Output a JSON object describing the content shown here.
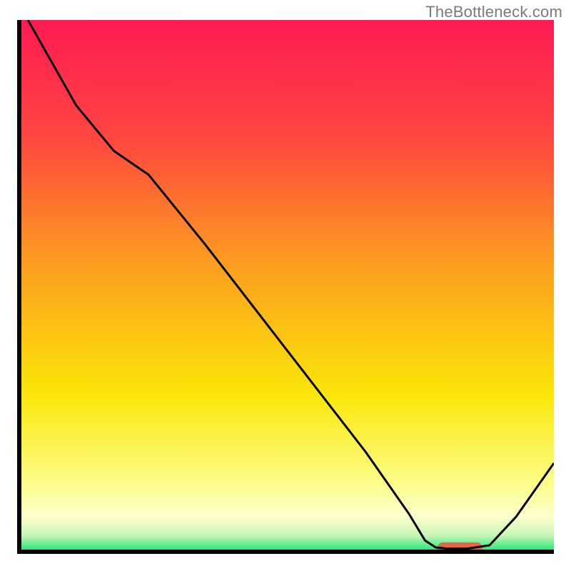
{
  "watermark": "TheBottleneck.com",
  "chart_data": {
    "type": "line",
    "title": "",
    "xlabel": "",
    "ylabel": "",
    "xlim": [
      0,
      100
    ],
    "ylim": [
      0,
      100
    ],
    "grid": false,
    "legend": "none",
    "gradient_stops": [
      {
        "offset": 0.0,
        "color": "#ff1a53"
      },
      {
        "offset": 0.22,
        "color": "#ff4640"
      },
      {
        "offset": 0.45,
        "color": "#fc9b20"
      },
      {
        "offset": 0.7,
        "color": "#fbe608"
      },
      {
        "offset": 0.86,
        "color": "#fdfc82"
      },
      {
        "offset": 0.93,
        "color": "#fdffcb"
      },
      {
        "offset": 0.965,
        "color": "#c8f7b6"
      },
      {
        "offset": 1.0,
        "color": "#00e46f"
      }
    ],
    "curve": [
      {
        "x": 2.0,
        "y": 100.0
      },
      {
        "x": 11.0,
        "y": 84.0
      },
      {
        "x": 18.0,
        "y": 75.5
      },
      {
        "x": 24.5,
        "y": 71.0
      },
      {
        "x": 35.0,
        "y": 58.0
      },
      {
        "x": 50.0,
        "y": 38.5
      },
      {
        "x": 65.0,
        "y": 19.0
      },
      {
        "x": 73.0,
        "y": 7.5
      },
      {
        "x": 76.0,
        "y": 2.5
      },
      {
        "x": 78.0,
        "y": 1.2
      },
      {
        "x": 80.0,
        "y": 1.0
      },
      {
        "x": 84.0,
        "y": 1.0
      },
      {
        "x": 88.0,
        "y": 1.6
      },
      {
        "x": 93.0,
        "y": 7.0
      },
      {
        "x": 100.0,
        "y": 17.0
      }
    ],
    "optimal_marker": {
      "x_center": 82.5,
      "x_half_width": 4.2,
      "y": 1.1,
      "height_pct": 1.3,
      "color": "#e0694d"
    },
    "axes_color": "#000000",
    "axes_width": 6
  }
}
